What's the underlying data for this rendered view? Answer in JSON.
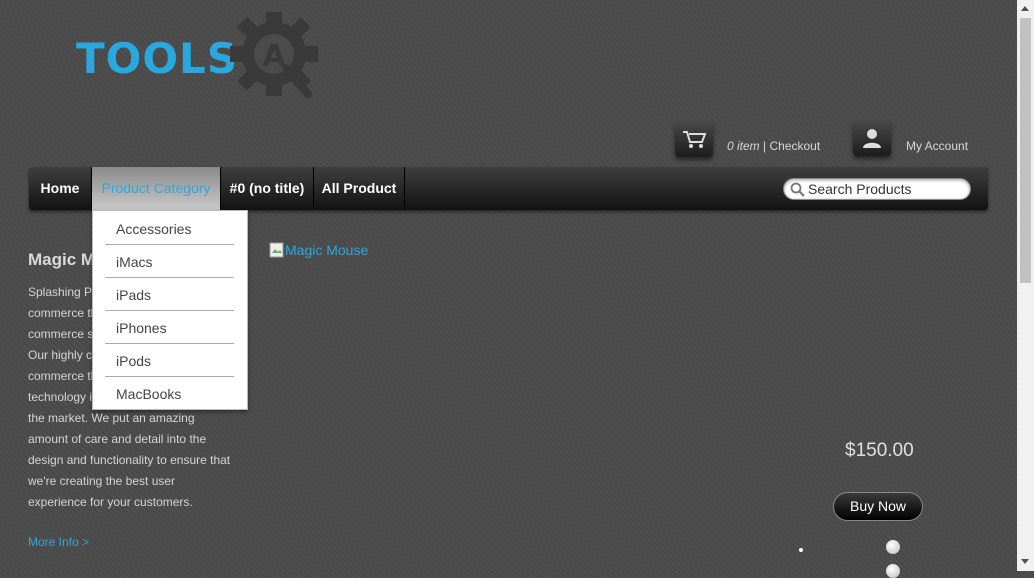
{
  "logo": {
    "text": "TOOLS",
    "emblem_letter": "A"
  },
  "header": {
    "cart_count": "0 item",
    "cart_separator": " | ",
    "checkout_label": "Checkout",
    "account_label": "My Account"
  },
  "nav": {
    "items": [
      {
        "label": "Home"
      },
      {
        "label": "Product Category"
      },
      {
        "label": "#0 (no title)"
      },
      {
        "label": "All Product"
      }
    ],
    "search_placeholder": "Search Products"
  },
  "dropdown": {
    "items": [
      "Accessories",
      "iMacs",
      "iPads",
      "iPhones",
      "iPods",
      "MacBooks"
    ]
  },
  "product": {
    "title": "Magic M",
    "desc_lines": [
      "Splashing P",
      "commerce th",
      "commerce s",
      "Our highly c",
      "commerce th",
      "technology is",
      "the market. We put an amazing",
      "amount of care and detail into the",
      "design and functionality to ensure that",
      "we're creating the best user",
      "experience for your customers."
    ],
    "more_info": "More Info >",
    "image_alt": "Magic Mouse",
    "price": "$150.00",
    "buy_label": "Buy Now"
  },
  "colors": {
    "accent": "#29a8e0",
    "background": "#4b4b4b"
  },
  "icons": [
    "gear-icon",
    "cart-icon",
    "user-icon",
    "search-icon",
    "broken-image-icon"
  ]
}
